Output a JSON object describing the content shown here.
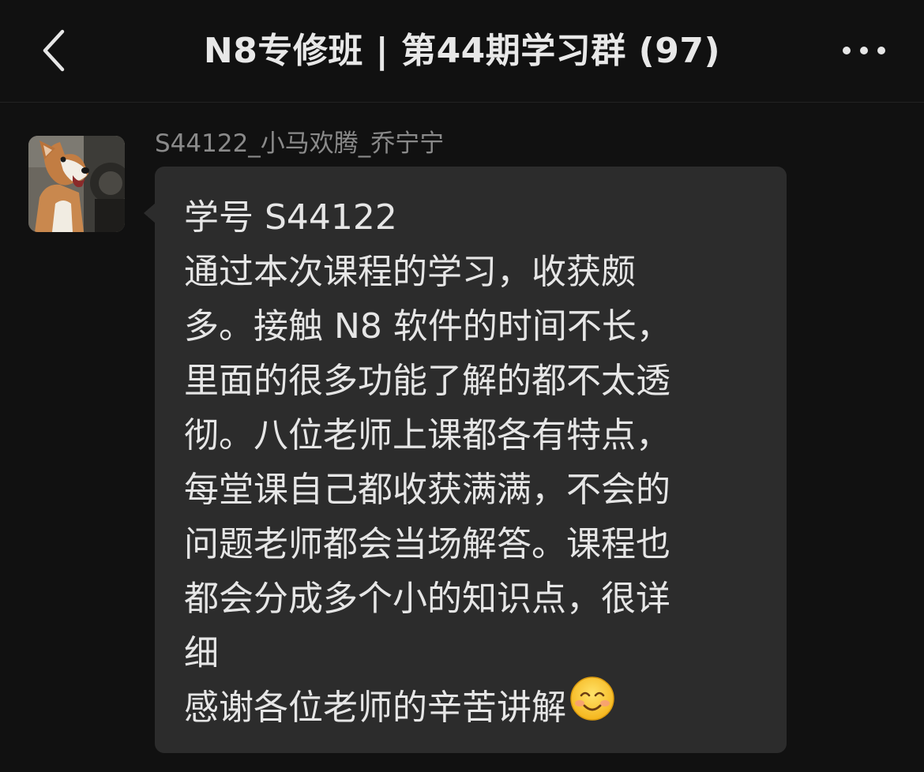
{
  "header": {
    "title": "N8专修班 | 第44期学习群 (97)",
    "back_icon": "chevron-left-icon",
    "more_icon": "more-horizontal-icon"
  },
  "message": {
    "sender": "S44122_小马欢腾_乔宁宁",
    "avatar": "corgi-dog-avatar",
    "lines": [
      "学号 S44122",
      "通过本次课程的学习，收获颇",
      "多。接触 N8 软件的时间不长，",
      "里面的很多功能了解的都不太透",
      "彻。八位老师上课都各有特点，",
      "每堂课自己都收获满满，不会的",
      "问题老师都会当场解答。课程也",
      "都会分成多个小的知识点，很详",
      "细",
      "感谢各位老师的辛苦讲解"
    ],
    "trailing_emoji": "smiling-face-emoji"
  },
  "colors": {
    "background": "#111111",
    "bubble": "#2c2c2c",
    "text": "#e6e6e6",
    "sender_name": "#8a8a8a"
  }
}
